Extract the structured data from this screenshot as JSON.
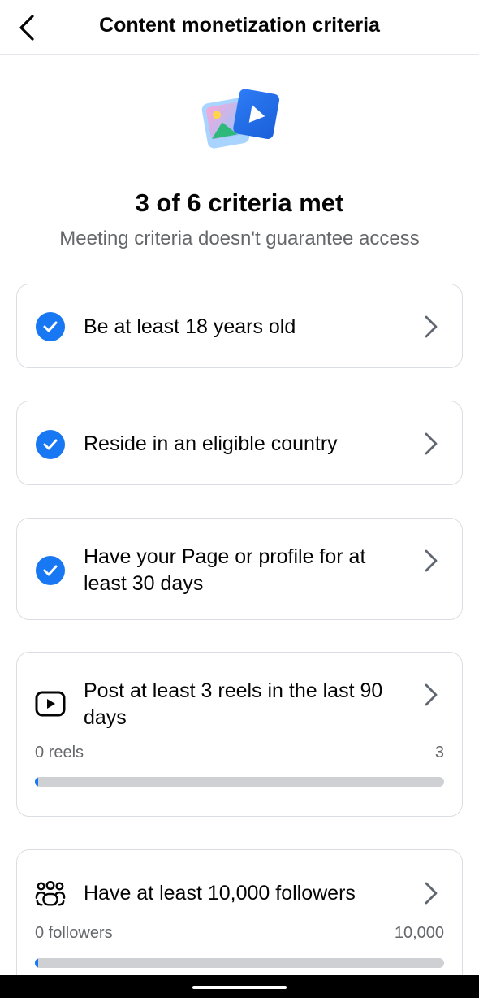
{
  "header": {
    "title": "Content monetization criteria"
  },
  "hero": {
    "title": "3 of 6 criteria met",
    "subtitle": "Meeting criteria doesn't guarantee access"
  },
  "criteria": [
    {
      "label": "Be at least 18 years old",
      "status": "met",
      "icon": "check-circle-icon"
    },
    {
      "label": "Reside in an eligible country",
      "status": "met",
      "icon": "check-circle-icon"
    },
    {
      "label": "Have your Page or profile for at least 30 days",
      "status": "met",
      "icon": "check-circle-icon"
    },
    {
      "label": "Post at least 3 reels in the last 90 days",
      "status": "not_met",
      "icon": "reels-icon",
      "progress": {
        "current_label": "0 reels",
        "target_label": "3",
        "fraction": 0
      }
    },
    {
      "label": "Have at least 10,000 followers",
      "status": "not_met",
      "icon": "followers-icon",
      "progress": {
        "current_label": "0 followers",
        "target_label": "10,000",
        "fraction": 0
      }
    }
  ],
  "colors": {
    "accent": "#1877f2",
    "track": "#ced0d4",
    "text_primary": "#050505",
    "text_secondary": "#65676b",
    "card_border": "#dadde1"
  }
}
